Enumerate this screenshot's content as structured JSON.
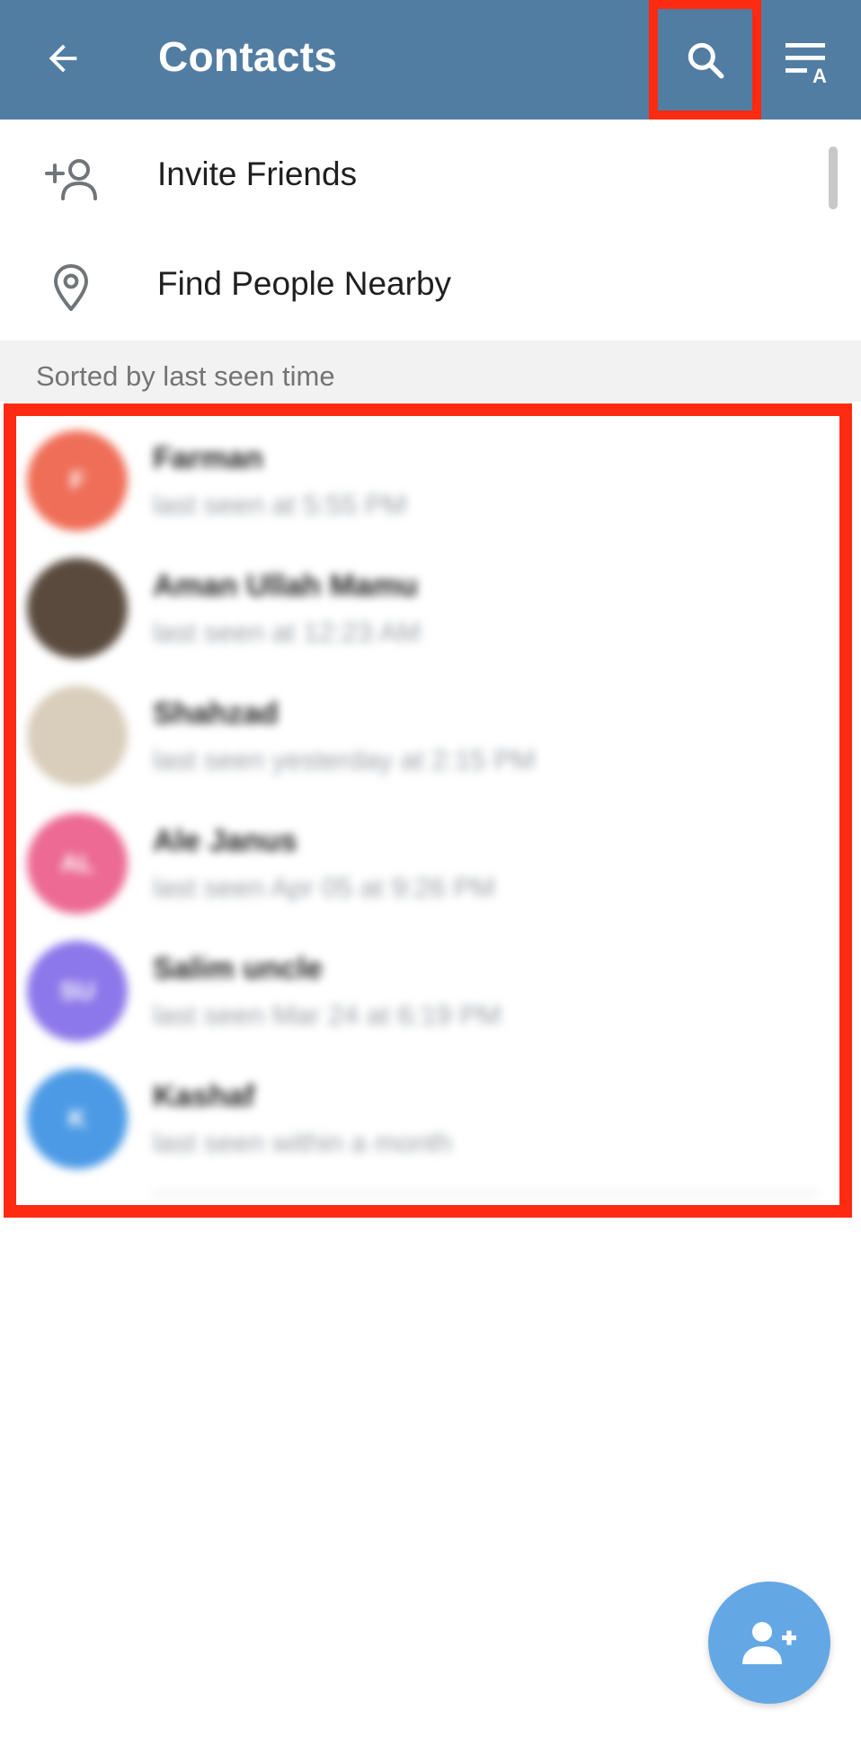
{
  "header": {
    "title": "Contacts",
    "back_icon": "arrow-left-icon",
    "search_icon": "search-icon",
    "sort_icon": "sort-alpha-icon",
    "background": "#527da3"
  },
  "menu": [
    {
      "label": "Invite Friends",
      "icon": "add-person-icon"
    },
    {
      "label": "Find People Nearby",
      "icon": "location-pin-icon"
    }
  ],
  "section_label": "Sorted by last seen time",
  "contacts": [
    {
      "name": "Farman",
      "status": "last seen at 5:55 PM",
      "initials": "F",
      "color": "#ef6e58"
    },
    {
      "name": "Aman Ullah Mamu",
      "status": "last seen at 12:23 AM",
      "initials": "",
      "color": "#5a4a3e"
    },
    {
      "name": "Shahzad",
      "status": "last seen yesterday at 2:15 PM",
      "initials": "",
      "color": "#d9cdbb"
    },
    {
      "name": "Ale Janus",
      "status": "last seen Apr 05 at 9:26 PM",
      "initials": "AL",
      "color": "#ec6a93"
    },
    {
      "name": "Salim uncle",
      "status": "last seen Mar 24 at 6:19 PM",
      "initials": "SU",
      "color": "#8c78ea"
    },
    {
      "name": "Kashaf",
      "status": "last seen within a month",
      "initials": "K",
      "color": "#4c9ae5"
    }
  ],
  "fab": {
    "icon": "add-contact-icon",
    "color": "#64a7e5"
  },
  "highlight_color": "#ff2a12"
}
